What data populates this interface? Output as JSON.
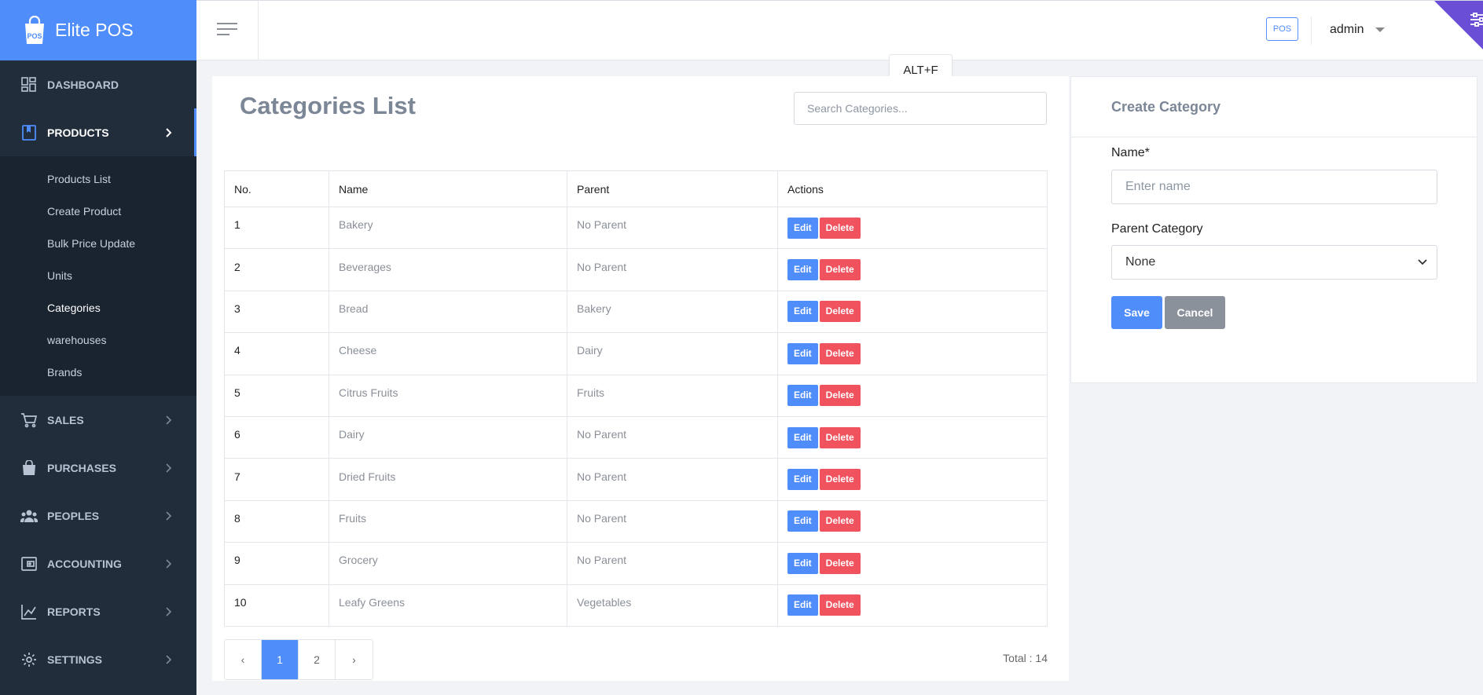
{
  "app": {
    "brand": "Elite POS",
    "logo_text": "POS"
  },
  "sidebar": {
    "items": [
      {
        "label": "DASHBOARD",
        "icon": "dashboard-icon"
      },
      {
        "label": "PRODUCTS",
        "icon": "book-icon"
      },
      {
        "label": "SALES",
        "icon": "cart-icon"
      },
      {
        "label": "PURCHASES",
        "icon": "bag-icon"
      },
      {
        "label": "PEOPLES",
        "icon": "people-icon"
      },
      {
        "label": "ACCOUNTING",
        "icon": "wallet-icon"
      },
      {
        "label": "REPORTS",
        "icon": "chart-line-icon"
      },
      {
        "label": "SETTINGS",
        "icon": "gear-icon"
      }
    ],
    "products_submenu": [
      "Products List",
      "Create Product",
      "Bulk Price Update",
      "Units",
      "Categories",
      "warehouses",
      "Brands"
    ]
  },
  "topbar": {
    "pos_label": "POS",
    "user": "admin"
  },
  "tooltip": "ALT+F",
  "categories": {
    "title": "Categories List",
    "search_placeholder": "Search Categories...",
    "columns": [
      "No.",
      "Name",
      "Parent",
      "Actions"
    ],
    "rows": [
      {
        "no": "1",
        "name": "Bakery",
        "parent": "No Parent"
      },
      {
        "no": "2",
        "name": "Beverages",
        "parent": "No Parent"
      },
      {
        "no": "3",
        "name": "Bread",
        "parent": "Bakery"
      },
      {
        "no": "4",
        "name": "Cheese",
        "parent": "Dairy"
      },
      {
        "no": "5",
        "name": "Citrus Fruits",
        "parent": "Fruits"
      },
      {
        "no": "6",
        "name": "Dairy",
        "parent": "No Parent"
      },
      {
        "no": "7",
        "name": "Dried Fruits",
        "parent": "No Parent"
      },
      {
        "no": "8",
        "name": "Fruits",
        "parent": "No Parent"
      },
      {
        "no": "9",
        "name": "Grocery",
        "parent": "No Parent"
      },
      {
        "no": "10",
        "name": "Leafy Greens",
        "parent": "Vegetables"
      }
    ],
    "edit_label": "Edit",
    "delete_label": "Delete",
    "pagination": {
      "prev": "‹",
      "pages": [
        "1",
        "2"
      ],
      "current": "1",
      "next": "›"
    },
    "total": "Total : 14"
  },
  "create": {
    "title": "Create Category",
    "name_label": "Name*",
    "name_placeholder": "Enter name",
    "parent_label": "Parent Category",
    "parent_value": "None",
    "save": "Save",
    "cancel": "Cancel"
  },
  "colors": {
    "primary": "#4f8dfb",
    "danger": "#f0525e",
    "sidebar": "#222d3c",
    "corner": "#6a4fd6"
  }
}
